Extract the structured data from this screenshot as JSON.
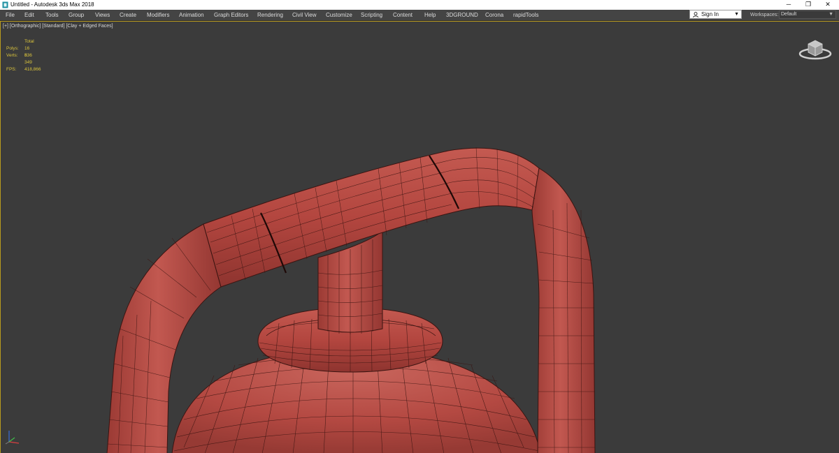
{
  "window": {
    "title": "Untitled - Autodesk 3ds Max 2018",
    "minimize_glyph": "─",
    "restore_glyph": "❐",
    "close_glyph": "✕"
  },
  "menu": {
    "items": [
      "File",
      "Edit",
      "Tools",
      "Group",
      "Views",
      "Create",
      "Modifiers",
      "Animation",
      "Graph Editors",
      "Rendering",
      "Civil View",
      "Customize",
      "Scripting",
      "Content",
      "Help",
      "3DGROUND",
      "Corona",
      "rapidTools"
    ]
  },
  "account": {
    "sign_in_label": "Sign In"
  },
  "workspaces": {
    "label": "Workspaces:",
    "value": "Default"
  },
  "viewport": {
    "label": "[+] [Orthographic] [Standard] [Clay + Edged Faces]",
    "stats": {
      "header": "Total",
      "polys_label": "Polys:",
      "polys_value": "16 536",
      "verts_label": "Verts:",
      "verts_value": "8 349",
      "fps_label": "FPS:",
      "fps_value": "418,866"
    }
  },
  "colors": {
    "viewport_bg": "#3b3b3b",
    "model_fill": "#b84a43",
    "wire": "#3a1411",
    "stats_text": "#d9c33c",
    "active_border": "#b89a1e"
  },
  "icons": [
    "app-icon",
    "user-icon",
    "viewcube-icon",
    "axis-tripod-icon"
  ]
}
